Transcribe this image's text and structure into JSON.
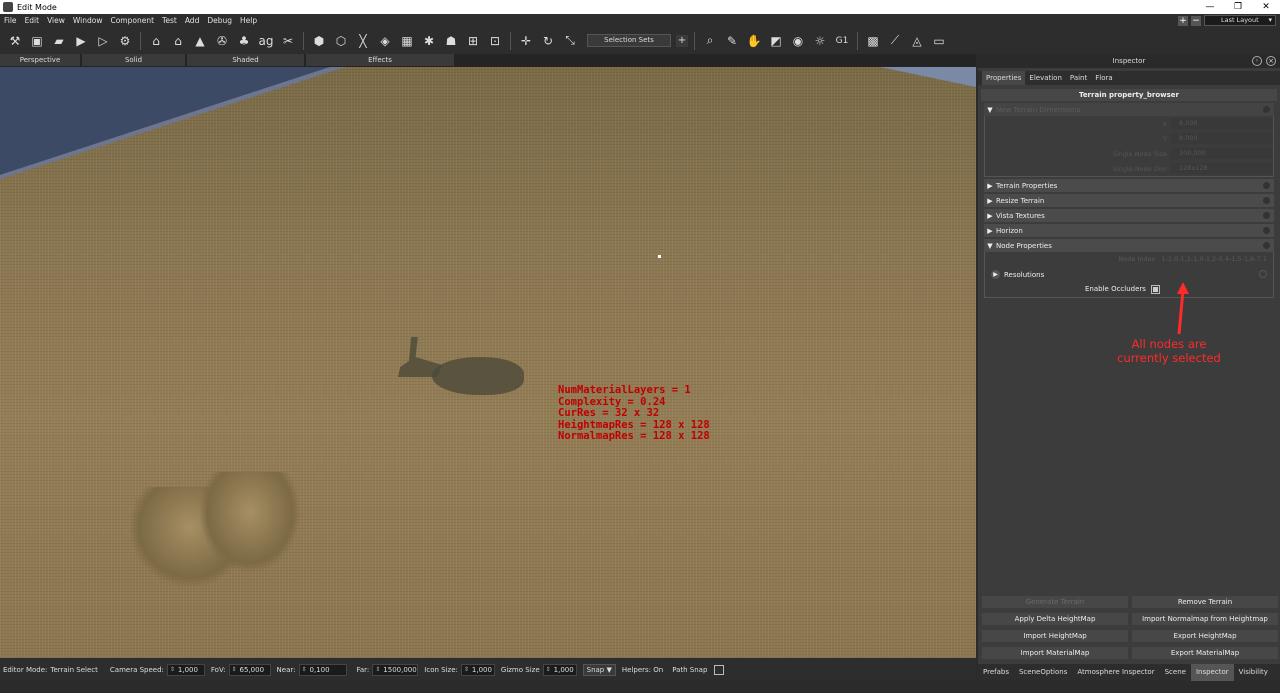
{
  "window": {
    "title": "Edit Mode"
  },
  "menu": [
    "File",
    "Edit",
    "View",
    "Window",
    "Component",
    "Test",
    "Add",
    "Debug",
    "Help"
  ],
  "layout_select": "Last Layout",
  "toolbar": {
    "selection_sets": "Selection Sets"
  },
  "view_tabs": [
    "Perspective",
    "Solid",
    "Shaded",
    "Effects"
  ],
  "debug_overlay": [
    "NumMaterialLayers = 1",
    "Complexity = 0.24",
    "CurRes = 32 x 32",
    "HeightmapRes = 128 x 128",
    "NormalmapRes = 128 x 128"
  ],
  "statusbar": {
    "mode_label": "Editor Mode:",
    "mode_value": "Terrain Select",
    "camera_speed_label": "Camera Speed:",
    "camera_speed": "1,000",
    "fov_label": "FoV:",
    "fov": "65,000",
    "near_label": "Near:",
    "near": "0,100",
    "far_label": "Far:",
    "far": "1500,000",
    "icon_size_label": "Icon Size:",
    "icon_size": "1,000",
    "gizmo_size_label": "Gizmo Size",
    "gizmo_size": "1,000",
    "snap": "Snap ▼",
    "helpers": "Helpers: On",
    "path_snap": "Path Snap"
  },
  "inspector": {
    "title": "Inspector",
    "tabs": [
      "Properties",
      "Elevation",
      "Paint",
      "Flora"
    ],
    "browser_title": "Terrain property_browser",
    "new_terrain_section": "New Terrain Dimensions",
    "dims": [
      {
        "label": "X",
        "value": "8,000"
      },
      {
        "label": "Y",
        "value": "8,000"
      },
      {
        "label": "Single Node Size",
        "value": "100,000"
      },
      {
        "label": "Single Node Dim",
        "value": "128x128"
      }
    ],
    "sections": [
      "Terrain Properties",
      "Resize Terrain",
      "Vista Textures",
      "Horizon",
      "Node Properties"
    ],
    "node_index_label": "Node Index",
    "node_index_value": "1-1,0-1,1-1,0-1,2-0,4-1,5-1,6-7,1",
    "resolutions": "Resolutions",
    "enable_occluders": "Enable Occluders",
    "buttons": [
      {
        "label": "Generate Terrain",
        "disabled": true
      },
      {
        "label": "Remove Terrain",
        "disabled": false
      },
      {
        "label": "Apply Delta HeightMap",
        "disabled": false
      },
      {
        "label": "Import Normalmap from Heightmap",
        "disabled": false
      },
      {
        "label": "Import HeightMap",
        "disabled": false
      },
      {
        "label": "Export HeightMap",
        "disabled": false
      },
      {
        "label": "Import MaterialMap",
        "disabled": false
      },
      {
        "label": "Export MaterialMap",
        "disabled": false
      }
    ]
  },
  "annotation": "All nodes are currently selected",
  "bottom_tabs": [
    "Prefabs",
    "SceneOptions",
    "Atmosphere Inspector",
    "Scene",
    "Inspector",
    "Visibility"
  ],
  "colors": {
    "annotation": "#ff2a2a",
    "debug_text": "#c00000"
  }
}
